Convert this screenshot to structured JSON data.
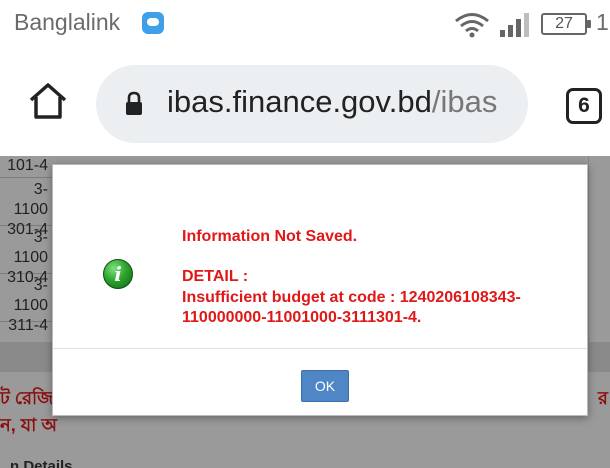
{
  "status_bar": {
    "carrier": "Banglalink",
    "battery_level": "27",
    "clock_partial": "1",
    "icons": [
      "message-icon",
      "wifi-icon",
      "signal-icon",
      "battery-icon"
    ]
  },
  "browser": {
    "url_domain": "ibas.finance.gov.bd",
    "url_path": "/ibas",
    "tab_count": "6",
    "icons": [
      "home-icon",
      "lock-icon",
      "tabs-icon"
    ]
  },
  "page": {
    "code_cells": [
      {
        "line1": "1100",
        "line2": "101-4"
      },
      {
        "line1": "3-1100",
        "line2": "301-4"
      },
      {
        "line1": "3-1100",
        "line2": "310-4"
      },
      {
        "line1": "3-1100",
        "line2": "311-4"
      }
    ],
    "bangla_line1": "ট রেজি",
    "bangla_line2": "ন, যা অ",
    "bangla_right": "র",
    "details_label": "n Details"
  },
  "dialog": {
    "title": "Information Not Saved.",
    "detail_label": "DETAIL :",
    "detail_line1": "Insufficient budget at code : 1240206108343-",
    "detail_line2": "110000000-11001000-3111301-4.",
    "ok_label": "OK",
    "icon": "info-icon",
    "text_color": "#e01818",
    "button_color": "#4f86c6"
  }
}
